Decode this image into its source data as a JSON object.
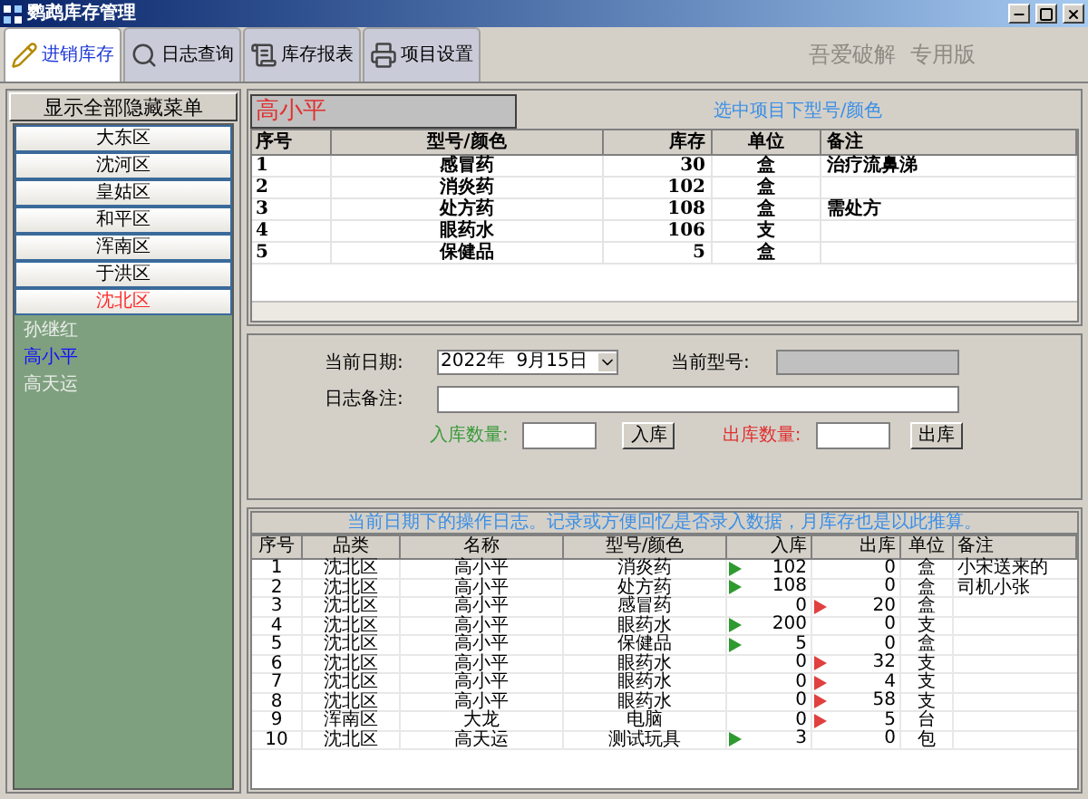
{
  "window": {
    "title": "鹦鹉库存管理"
  },
  "toolbar": {
    "tabs": [
      {
        "label": "进销库存",
        "selected": true
      },
      {
        "label": "日志查询",
        "selected": false
      },
      {
        "label": "库存报表",
        "selected": false
      },
      {
        "label": "项目设置",
        "selected": false
      }
    ],
    "edition_note": "吾爱破解  专用版"
  },
  "sidebar": {
    "toggle_button": "显示全部隐藏菜单",
    "districts": [
      {
        "label": "大东区",
        "selected": false
      },
      {
        "label": "沈河区",
        "selected": false
      },
      {
        "label": "皇姑区",
        "selected": false
      },
      {
        "label": "和平区",
        "selected": false
      },
      {
        "label": "浑南区",
        "selected": false
      },
      {
        "label": "于洪区",
        "selected": false
      },
      {
        "label": "沈北区",
        "selected": true
      }
    ],
    "people": [
      {
        "label": "孙继红",
        "selected": false
      },
      {
        "label": "高小平",
        "selected": true
      },
      {
        "label": "高天运",
        "selected": false
      }
    ]
  },
  "stock": {
    "person": "高小平",
    "hint": "选中项目下型号/颜色",
    "columns": [
      "序号",
      "型号/颜色",
      "库存",
      "单位",
      "备注"
    ],
    "rows": [
      {
        "no": "1",
        "model": "感冒药",
        "stock": "30",
        "unit": "盒",
        "note": "治疗流鼻涕"
      },
      {
        "no": "2",
        "model": "消炎药",
        "stock": "102",
        "unit": "盒"
      },
      {
        "no": "3",
        "model": "处方药",
        "stock": "108",
        "unit": "盒",
        "note": "需处方"
      },
      {
        "no": "4",
        "model": "眼药水",
        "stock": "106",
        "unit": "支"
      },
      {
        "no": "5",
        "model": "保健品",
        "stock": "5",
        "unit": "盒"
      }
    ]
  },
  "form": {
    "date_label": "当前日期:",
    "date_value": "2022年  9月15日",
    "model_label": "当前型号:",
    "memo_label": "日志备注:",
    "in_label": "入库数量:",
    "in_button": "入库",
    "out_label": "出库数量:",
    "out_button": "出库"
  },
  "log": {
    "banner": "当前日期下的操作日志。记录或方便回忆是否录入数据，月库存也是以此推算。",
    "columns": [
      "序号",
      "品类",
      "名称",
      "型号/颜色",
      "入库",
      "出库",
      "单位",
      "备注"
    ],
    "rows": [
      {
        "no": "1",
        "category": "沈北区",
        "name": "高小平",
        "model": "消炎药",
        "in": "102",
        "out": "0",
        "unit": "盒",
        "note": "小宋送来的",
        "kind": "in"
      },
      {
        "no": "2",
        "category": "沈北区",
        "name": "高小平",
        "model": "处方药",
        "in": "108",
        "out": "0",
        "unit": "盒",
        "note": "司机小张",
        "kind": "in"
      },
      {
        "no": "3",
        "category": "沈北区",
        "name": "高小平",
        "model": "感冒药",
        "in": "0",
        "out": "20",
        "unit": "盒",
        "kind": "out"
      },
      {
        "no": "4",
        "category": "沈北区",
        "name": "高小平",
        "model": "眼药水",
        "in": "200",
        "out": "0",
        "unit": "支",
        "kind": "in"
      },
      {
        "no": "5",
        "category": "沈北区",
        "name": "高小平",
        "model": "保健品",
        "in": "5",
        "out": "0",
        "unit": "盒",
        "kind": "in"
      },
      {
        "no": "6",
        "category": "沈北区",
        "name": "高小平",
        "model": "眼药水",
        "in": "0",
        "out": "32",
        "unit": "支",
        "kind": "out"
      },
      {
        "no": "7",
        "category": "沈北区",
        "name": "高小平",
        "model": "眼药水",
        "in": "0",
        "out": "4",
        "unit": "支",
        "kind": "out"
      },
      {
        "no": "8",
        "category": "沈北区",
        "name": "高小平",
        "model": "眼药水",
        "in": "0",
        "out": "58",
        "unit": "支",
        "kind": "out"
      },
      {
        "no": "9",
        "category": "浑南区",
        "name": "大龙",
        "model": "电脑",
        "in": "0",
        "out": "5",
        "unit": "台",
        "kind": "out"
      },
      {
        "no": "10",
        "category": "沈北区",
        "name": "高天运",
        "model": "测试玩具",
        "in": "3",
        "out": "0",
        "unit": "包",
        "kind": "in"
      }
    ]
  }
}
